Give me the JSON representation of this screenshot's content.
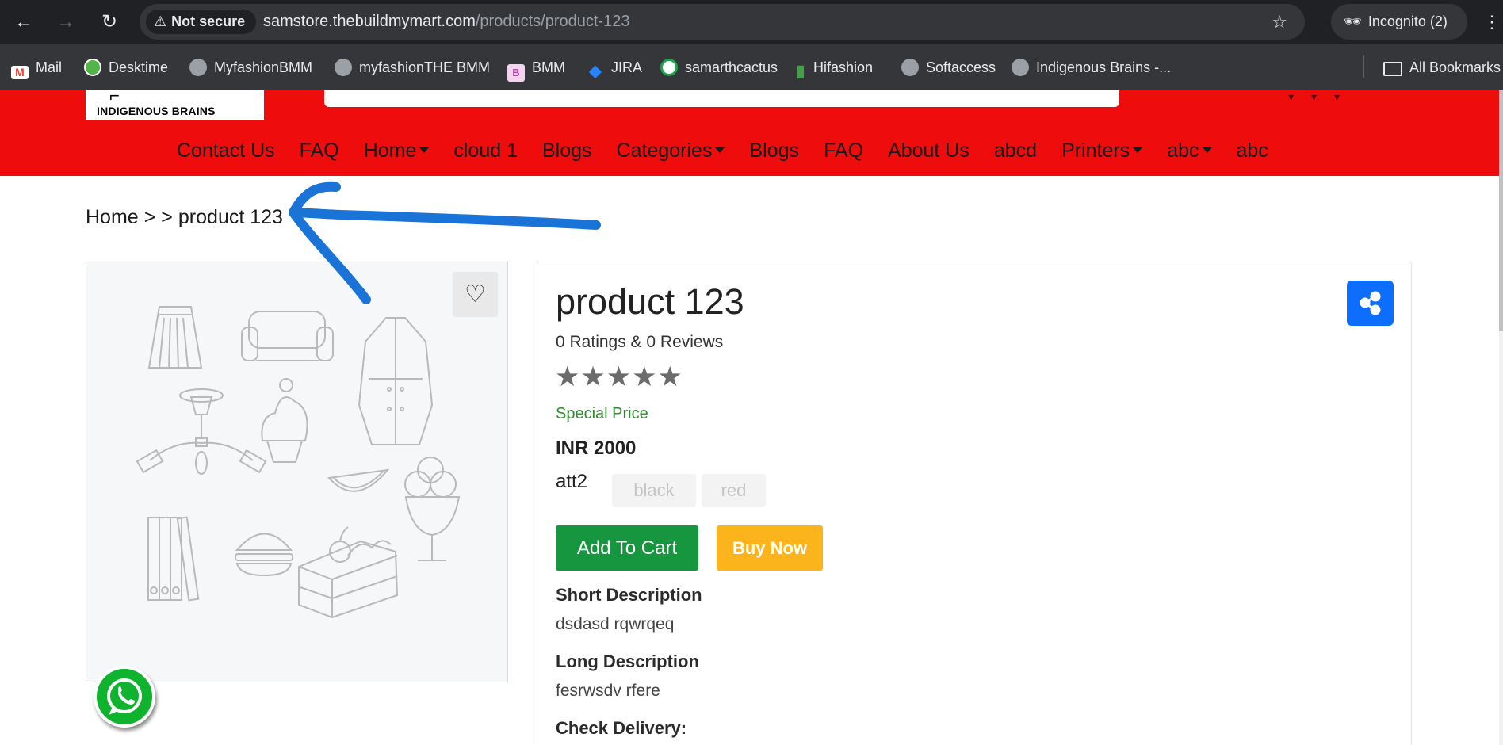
{
  "browser": {
    "back": "←",
    "forward": "→",
    "reload": "↻",
    "security": "Not secure",
    "security_icon": "⚠",
    "url_host": "samstore.thebuildmymart.com",
    "url_path": "/products/product-123",
    "star_icon": "☆",
    "profile_label": "Incognito (2)",
    "profile_icon": "🕶",
    "menu_icon": "⋮"
  },
  "bookmarks": [
    {
      "label": "Mail",
      "icon": "gmail-icon",
      "color": "#ea4335"
    },
    {
      "label": "Desktime",
      "icon": "desktime-icon",
      "color": "#53b447"
    },
    {
      "label": "MyfashionBMM",
      "icon": "globe-icon",
      "color": "#9aa0a6"
    },
    {
      "label": "myfashionTHE BMM",
      "icon": "globe-icon",
      "color": "#9aa0a6"
    },
    {
      "label": "BMM",
      "icon": "bmm-icon",
      "color": "#c13bb6"
    },
    {
      "label": "JIRA",
      "icon": "jira-icon",
      "color": "#2684ff"
    },
    {
      "label": "samarthcactus",
      "icon": "cactus-icon",
      "color": "#1aa64a"
    },
    {
      "label": "Hifashion",
      "icon": "hifashion-icon",
      "color": "#43a047"
    },
    {
      "label": "Softaccess",
      "icon": "globe-icon",
      "color": "#9aa0a6"
    },
    {
      "label": "Indigenous Brains -...",
      "icon": "globe-icon",
      "color": "#9aa0a6"
    },
    {
      "label": "All Bookmarks",
      "icon": "folder-icon",
      "color": "#e8eaed"
    }
  ],
  "site": {
    "logo_text": "INDIGENOUS BRAINS",
    "menu": [
      {
        "label": "Contact Us",
        "dropdown": false
      },
      {
        "label": "FAQ",
        "dropdown": false
      },
      {
        "label": "Home",
        "dropdown": true
      },
      {
        "label": "cloud 1",
        "dropdown": false
      },
      {
        "label": "Blogs",
        "dropdown": false
      },
      {
        "label": "Categories",
        "dropdown": true
      },
      {
        "label": "Blogs",
        "dropdown": false
      },
      {
        "label": "FAQ",
        "dropdown": false
      },
      {
        "label": "About Us",
        "dropdown": false
      },
      {
        "label": "abcd",
        "dropdown": false
      },
      {
        "label": "Printers",
        "dropdown": true
      },
      {
        "label": "abc",
        "dropdown": true
      },
      {
        "label": "abc",
        "dropdown": false
      }
    ]
  },
  "breadcrumb": {
    "home": "Home",
    "sep": ">",
    "current": "product 123"
  },
  "product": {
    "title": "product 123",
    "ratings_text": "0 Ratings & 0 Reviews",
    "stars": "★★★★★",
    "rating": 0,
    "special_price_label": "Special Price",
    "price": "INR 2000",
    "attribute_label": "att2",
    "attribute_options": [
      "black",
      "red"
    ],
    "add_to_cart": "Add To Cart",
    "buy_now": "Buy Now",
    "short_desc_heading": "Short Description",
    "short_desc": "dsdasd rqwrqeq",
    "long_desc_heading": "Long Description",
    "long_desc": "fesrwsdv rfere",
    "delivery_heading": "Check Delivery:"
  },
  "colors": {
    "header_red": "#ee0c0c",
    "cart_green": "#15963f",
    "buy_yellow": "#fbb41b",
    "share_blue": "#0d6efd",
    "annotation_blue": "#1a73d6"
  }
}
